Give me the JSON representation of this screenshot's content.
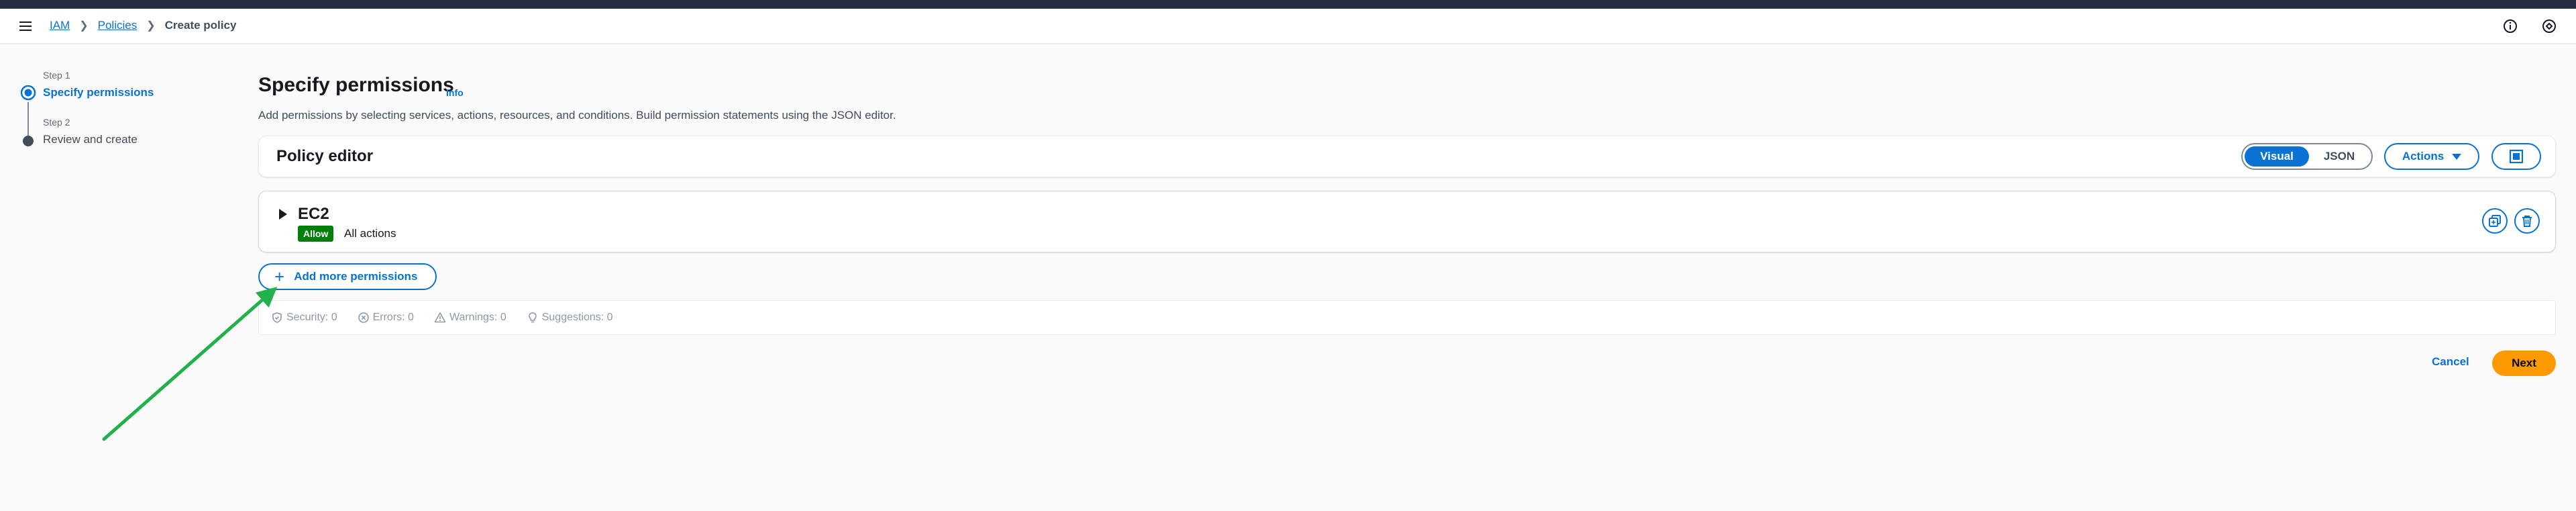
{
  "breadcrumb": {
    "items": [
      "IAM",
      "Policies"
    ],
    "current": "Create policy"
  },
  "steps": [
    {
      "label": "Step 1",
      "title": "Specify permissions"
    },
    {
      "label": "Step 2",
      "title": "Review and create"
    }
  ],
  "page": {
    "title": "Specify permissions",
    "info": "Info",
    "description": "Add permissions by selecting services, actions, resources, and conditions. Build permission statements using the JSON editor."
  },
  "editor": {
    "title": "Policy editor",
    "modes": [
      "Visual",
      "JSON"
    ],
    "actions_label": "Actions"
  },
  "statement": {
    "service": "EC2",
    "effect": "Allow",
    "actions": "All actions"
  },
  "add_permissions_label": "Add more permissions",
  "validation": [
    "Security: 0",
    "Errors: 0",
    "Warnings: 0",
    "Suggestions: 0"
  ],
  "footer": {
    "cancel": "Cancel",
    "next": "Next"
  },
  "colors": {
    "accent": "#0972d3",
    "allow": "#037f0c",
    "primary": "#ff9900",
    "annotation_arrow": "#22b04a"
  },
  "icons": [
    "menu-icon",
    "chevron-right-icon",
    "info-circle-icon",
    "feedback-icon",
    "fullscreen-icon",
    "copy-icon",
    "trash-icon",
    "plus-icon",
    "shield-icon",
    "x-circle-icon",
    "warning-icon",
    "lightbulb-icon"
  ]
}
